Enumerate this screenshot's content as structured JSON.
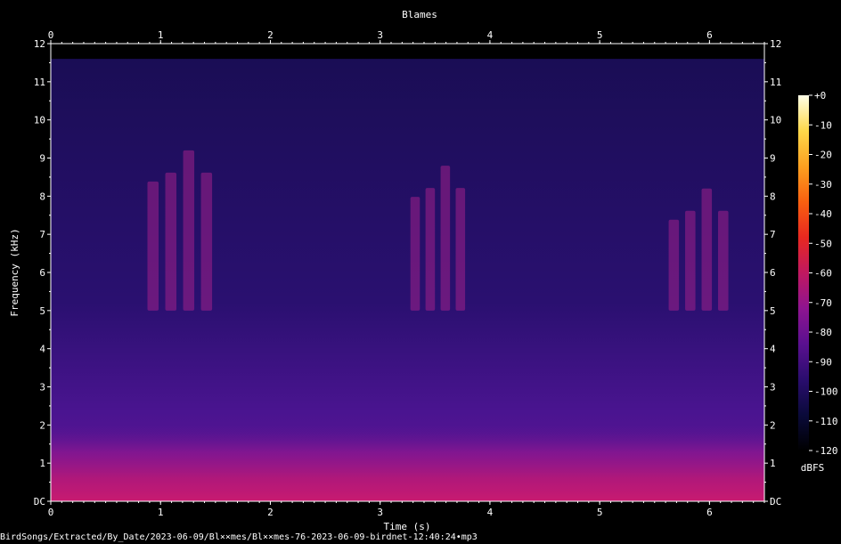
{
  "file_path": "BirdSongs/Extracted/By_Date/2023-06-09/Bl××mes/Bl××mes-76-2023-06-09-birdnet-12:40:24•mp3",
  "chart_data": {
    "type": "heatmap",
    "title": "Blames",
    "xlabel": "Time (s)",
    "ylabel": "Frequency (kHz)",
    "xlim": [
      0,
      6.5
    ],
    "ylim": [
      0,
      12
    ],
    "x_ticks": [
      "0",
      "1",
      "2",
      "3",
      "4",
      "5",
      "6"
    ],
    "y_ticks": [
      "DC",
      "1",
      "2",
      "3",
      "4",
      "5",
      "6",
      "7",
      "8",
      "9",
      "10",
      "11",
      "12"
    ],
    "colorbar": {
      "unit": "dBFS",
      "ticks": [
        "+0",
        "-10",
        "-20",
        "-30",
        "-40",
        "-50",
        "-60",
        "-70",
        "-80",
        "-90",
        "-100",
        "-110",
        "-120"
      ],
      "range": [
        -120,
        0
      ],
      "colors": [
        "#000000",
        "#0a0a3a",
        "#2a0d6e",
        "#5a1090",
        "#8e1490",
        "#c01860",
        "#e82820",
        "#f86010",
        "#fca020",
        "#fdd84a",
        "#ffffe8"
      ]
    },
    "noise_ceiling_khz": 11.6,
    "calls": [
      {
        "t_start": 0.85,
        "t_end": 1.5,
        "f_low": 5.0,
        "f_high": 9.2
      },
      {
        "t_start": 3.25,
        "t_end": 3.8,
        "f_low": 5.0,
        "f_high": 8.8
      },
      {
        "t_start": 5.6,
        "t_end": 6.2,
        "f_low": 5.0,
        "f_high": 8.2
      }
    ]
  }
}
